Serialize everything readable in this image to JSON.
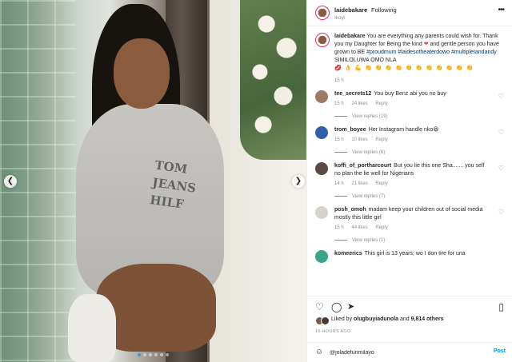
{
  "photo": {
    "hoodie_print_lines": [
      "TOM",
      "JEANS",
      "HILF"
    ],
    "carousel_dots": 6,
    "active_dot": 0,
    "nav_prev_icon": "chevron-left-icon",
    "nav_next_icon": "chevron-right-icon"
  },
  "header": {
    "username": "laidebakare",
    "separator": "•",
    "follow_status": "Following",
    "location": "Ikoyi",
    "more_icon": "more-horizontal-icon"
  },
  "caption": {
    "username": "laidebakare",
    "text": "You are everything any parents could wish for. Thank you my Daughter for Being the kind",
    "text2": "and gentle person you have grown to BE",
    "hashtags": "#proudmum #laidesotheaterdowo #multipleIandandy",
    "text3": "SIMILOLUWA OMO NLA",
    "emoji_line": "💋 👌 💪 👏 👏 👏 👏 👏 👏 👏 👏 👏 👏 👏",
    "time": "15 h"
  },
  "comments": [
    {
      "username": "tee_secrets12",
      "text": "You buy Benz abi you no buy",
      "time": "15 h",
      "likes": "24 likes",
      "reply_label": "Reply",
      "view_replies": "View replies (19)",
      "avatar_color": "#9c7a66"
    },
    {
      "username": "trom_boyee",
      "text": "Her Instagram handle nko😆",
      "time": "15 h",
      "likes": "10 likes",
      "reply_label": "Reply",
      "view_replies": "View replies (6)",
      "avatar_color": "#2f5fa8"
    },
    {
      "username": "koffi_of_portharcourt",
      "text": "But you lie this one Sha....... you self no plan the lie well for Nigerians",
      "time": "14 h",
      "likes": "21 likes",
      "reply_label": "Reply",
      "view_replies": "View replies (7)",
      "avatar_color": "#5a4a44"
    },
    {
      "username": "posh_omoh",
      "text": "madam keep your children out of social media mostly this little girl",
      "time": "15 h",
      "likes": "44 likes",
      "reply_label": "Reply",
      "view_replies": "View replies (1)",
      "avatar_color": "#d8d2cc"
    },
    {
      "username": "komeerics",
      "text": "This girl is 13 years; wo I don tire for una",
      "avatar_color": "#3aa58a"
    }
  ],
  "actions": {
    "like_icon": "heart-icon",
    "comment_icon": "comment-icon",
    "share_icon": "paper-plane-icon",
    "save_icon": "bookmark-icon"
  },
  "likes": {
    "liked_by_prefix": "Liked by",
    "liked_by_user": "olugbuyiadunola",
    "and_text": "and",
    "others": "9,814 others"
  },
  "post_date": "15 HOURS AGO",
  "add_comment": {
    "emoji_icon": "smiley-icon",
    "value": "@joladefunmilayo",
    "post_label": "Post"
  },
  "colors": {
    "link": "#00376b",
    "post_button": "#0095f6",
    "muted": "#8e8e8e",
    "story_ring": "#e1306c"
  }
}
